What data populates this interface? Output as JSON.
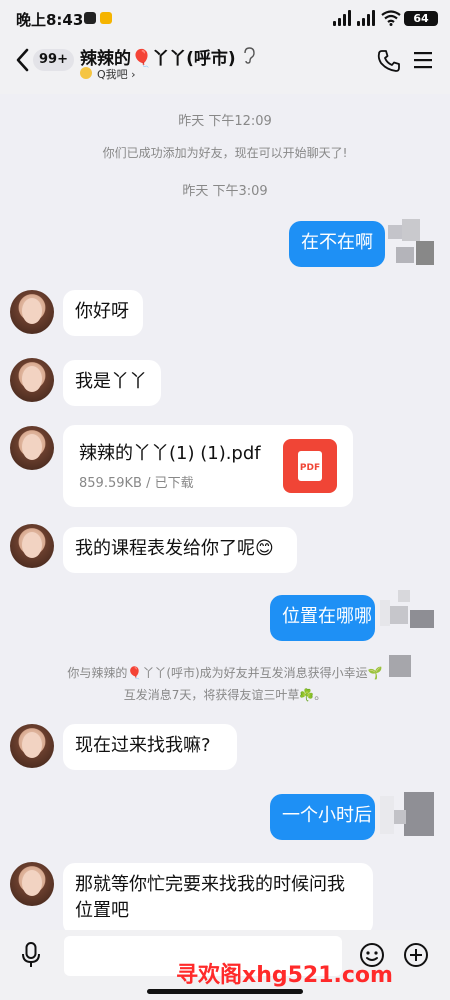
{
  "status_bar": {
    "time": "晚上8:43",
    "battery": "64"
  },
  "header": {
    "unread_count": "99+",
    "contact_name": "辣辣的🎈丫丫(呼市)",
    "sub_label": "Q我吧 ›"
  },
  "chat": {
    "time_1": "昨天 下午12:09",
    "system_added": "你们已成功添加为好友，现在可以开始聊天了!",
    "time_2": "昨天 下午3:09",
    "msg_out_1": "在不在啊",
    "msg_in_1": "你好呀",
    "msg_in_2": "我是丫丫",
    "file": {
      "name": "辣辣的丫丫(1) (1).pdf",
      "meta": "859.59KB / 已下载",
      "badge": "PDF"
    },
    "msg_in_3": "我的课程表发给你了呢😊",
    "msg_out_2": "位置在哪哪",
    "system_friendship_1": "你与辣辣的🎈丫丫(呼市)成为好友并互发消息获得小幸运🌱",
    "system_friendship_2": "互发消息7天，将获得友谊三叶草☘️。",
    "msg_in_4": "现在过来找我嘛?",
    "msg_out_3": "一个小时后",
    "msg_in_5_line1": "那就等你忙完要来找我的时候问我",
    "msg_in_5_line2": "位置吧"
  },
  "input_bar": {
    "placeholder": "",
    "watermark": "寻欢阁xhg521.com"
  },
  "colors": {
    "accent_blue": "#1e90f5",
    "pdf_red": "#f04536",
    "watermark_red": "#ff2a2a"
  }
}
